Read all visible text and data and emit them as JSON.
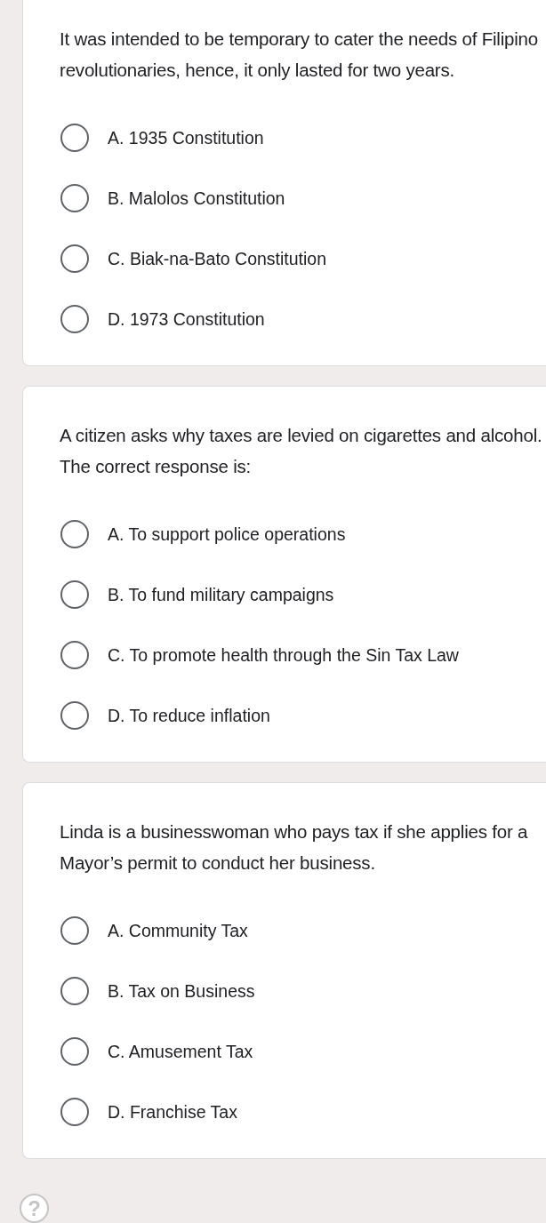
{
  "questions": [
    {
      "text": "It was intended to be temporary to cater the needs of Filipino revolutionaries, hence, it only lasted for two years.",
      "options": [
        {
          "label": "A. 1935 Constitution",
          "selected": false
        },
        {
          "label": "B. Malolos Constitution",
          "selected": false
        },
        {
          "label": "C. Biak-na-Bato Constitution",
          "selected": false
        },
        {
          "label": "D. 1973 Constitution",
          "selected": false
        }
      ]
    },
    {
      "text": "A citizen asks why taxes are levied on cigarettes and alcohol. The correct response is:",
      "options": [
        {
          "label": "A. To support police operations",
          "selected": false
        },
        {
          "label": "B. To fund military campaigns",
          "selected": false
        },
        {
          "label": "C. To promote health through the Sin Tax Law",
          "selected": false
        },
        {
          "label": "D. To reduce inflation",
          "selected": false
        }
      ]
    },
    {
      "text": "Linda is a businesswoman who pays tax if she applies for a Mayor’s permit to conduct her business.",
      "options": [
        {
          "label": "A. Community Tax",
          "selected": false
        },
        {
          "label": "B. Tax on Business",
          "selected": false
        },
        {
          "label": "C. Amusement Tax",
          "selected": false
        },
        {
          "label": "D. Franchise Tax",
          "selected": false
        }
      ]
    }
  ],
  "help_button": {
    "label": "?"
  }
}
